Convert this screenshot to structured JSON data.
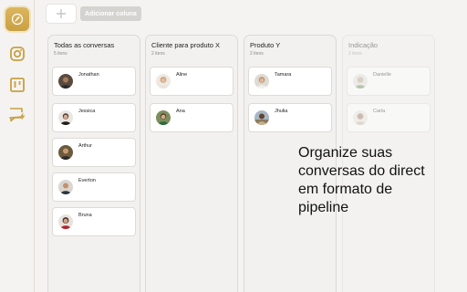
{
  "toolbar": {
    "add_column_label": "Adicionar coluna"
  },
  "sidebar": {
    "items": [
      {
        "icon": "leaf-logo-icon"
      },
      {
        "icon": "instagram-icon"
      },
      {
        "icon": "kanban-board-icon"
      },
      {
        "icon": "chat-bolt-icon"
      }
    ]
  },
  "columns": [
    {
      "title": "Todas as conversas",
      "count": "5 itens",
      "cards": [
        {
          "name": "Jonathan"
        },
        {
          "name": "Jessica"
        },
        {
          "name": "Arthur"
        },
        {
          "name": "Everton"
        },
        {
          "name": "Bruna"
        }
      ]
    },
    {
      "title": "Cliente para produto X",
      "count": "2 itens",
      "cards": [
        {
          "name": "Aline"
        },
        {
          "name": "Ana"
        }
      ]
    },
    {
      "title": "Produto Y",
      "count": "2 itens",
      "cards": [
        {
          "name": "Tamara"
        },
        {
          "name": "Jhulia"
        }
      ]
    },
    {
      "title": "Indicação",
      "count": "2 itens",
      "cards": [
        {
          "name": "Danielle"
        },
        {
          "name": "Carla"
        }
      ]
    }
  ],
  "overlay": {
    "line1": "Organize suas",
    "line2": "conversas do direct",
    "line3": "em formato de",
    "line4": "pipeline"
  },
  "colors": {
    "accent": "#c9a043",
    "background": "#f4f3f1",
    "card": "#ffffff"
  }
}
